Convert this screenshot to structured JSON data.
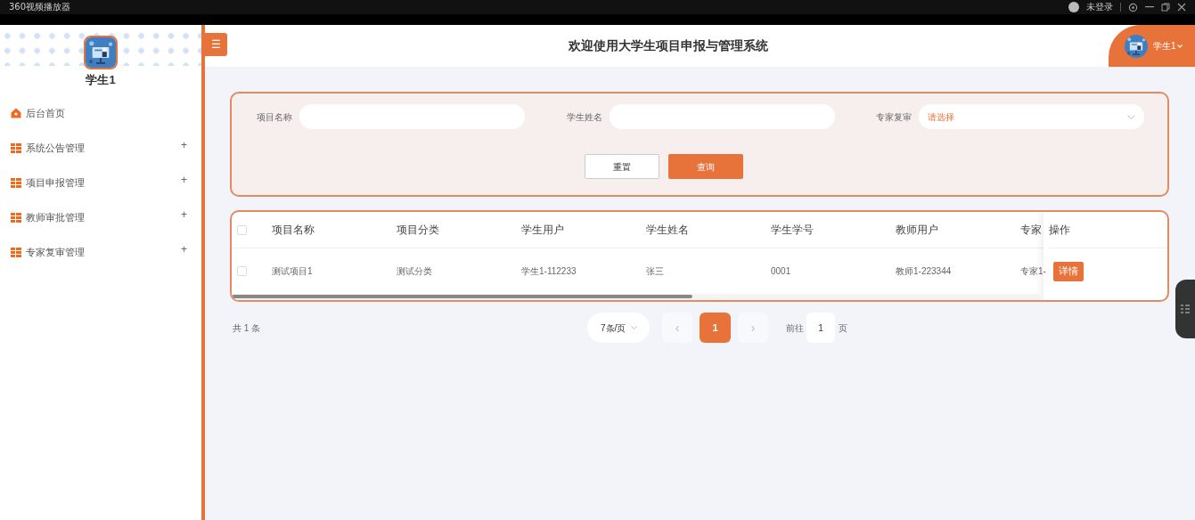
{
  "player_bar": {
    "title": "360视频播放器",
    "login": "未登录"
  },
  "sidebar": {
    "user": "学生1",
    "items": [
      {
        "label": "后台首页",
        "kind": "home"
      },
      {
        "label": "系统公告管理",
        "kind": "group",
        "expand": "+"
      },
      {
        "label": "项目申报管理",
        "kind": "group",
        "expand": "+"
      },
      {
        "label": "教师审批管理",
        "kind": "group",
        "expand": "+"
      },
      {
        "label": "专家复审管理",
        "kind": "group",
        "expand": "+"
      }
    ]
  },
  "header": {
    "menu_toggle": "☰",
    "title": "欢迎使用大学生项目申报与管理系统",
    "user": "学生1"
  },
  "search": {
    "fields": [
      {
        "label": "项目名称",
        "kind": "input"
      },
      {
        "label": "学生姓名",
        "kind": "input"
      },
      {
        "label": "专家复审",
        "kind": "select",
        "placeholder": "请选择"
      }
    ],
    "buttons": [
      {
        "label": "重置",
        "kind": "plain"
      },
      {
        "label": "查询",
        "kind": "primary"
      }
    ]
  },
  "table": {
    "all_checked": false,
    "columns": [
      "项目名称",
      "项目分类",
      "学生用户",
      "学生姓名",
      "学生学号",
      "教师用户",
      "专家"
    ],
    "action_column": "操作",
    "rows": [
      {
        "checked": false,
        "cells": [
          "测试项目1",
          "测试分类",
          "学生1-112233",
          "张三",
          "0001",
          "教师1-223344",
          "专家1-"
        ],
        "action": "详情"
      }
    ]
  },
  "pagination": {
    "total": "共 1 条",
    "page_size": "7条/页",
    "prev": "‹",
    "next": "›",
    "pages": [
      {
        "label": "1",
        "selected": true
      }
    ],
    "goto_label": "前往",
    "goto_value": "1",
    "goto_suffix": "页"
  }
}
